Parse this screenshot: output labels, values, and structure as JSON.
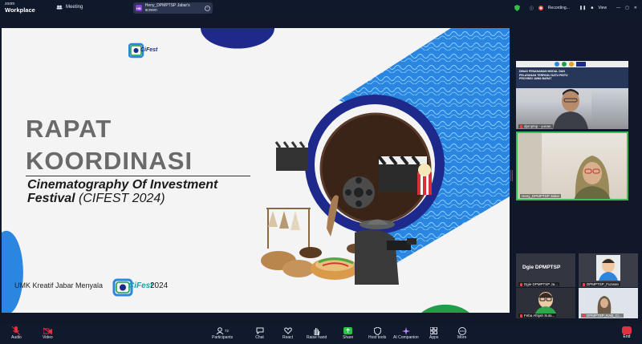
{
  "topbar": {
    "brand_zoom": "zoom",
    "brand_workplace": "Workplace",
    "meeting_label": "Meeting",
    "share_badge": "HB",
    "share_label": "Heny_DPMPTSP Jabar's screen",
    "recording_label": "Recording...",
    "view_label": "View"
  },
  "slide": {
    "title_line1": "RAPAT",
    "title_line2": "KOORDINASI",
    "subtitle_line1": "Cinematography Of Investment",
    "subtitle_line2_a": "Festival",
    "subtitle_line2_b": " (CIFEST 2024)",
    "logo_text": "CiFest",
    "footer_text": "UMK Kreatif Jabar Menyala",
    "footer_logo_text": "CiFest",
    "footer_year": "2024",
    "banner_text": "DINAS PENANAMAN MODAL DAN PELAYANAN TERPADU SATU PINTU PROVINSI JAWA BARAT"
  },
  "participants": [
    {
      "name": "dpmptsp - yunan",
      "muted": true
    },
    {
      "name": "Heny_DPMPTSP Jabar",
      "muted": false
    },
    {
      "name": "Dgie DPMPTSP Ja...",
      "muted": true,
      "display_name": "Dgie DPMPTSP"
    },
    {
      "name": "DPMPTSP_Fuzwan",
      "muted": true
    },
    {
      "name": "Feba Afrijah Suta...",
      "muted": true
    },
    {
      "name": "DPMPTSP_KAB_Ci...",
      "muted": true
    }
  ],
  "toolbar": {
    "participants_count": "72",
    "items": [
      "Audio",
      "Video",
      "Participants",
      "Chat",
      "React",
      "Raise hand",
      "Share",
      "Host tools",
      "AI Companion",
      "Apps",
      "More"
    ],
    "end_label": "End"
  },
  "colors": {
    "title_gray": "#6a6a6a",
    "accent_navy": "#1d2a8c",
    "accent_blue": "#2a86e0",
    "accent_green": "#1f9e4a",
    "active_speaker": "#34c35a",
    "end_red": "#e0323e"
  }
}
